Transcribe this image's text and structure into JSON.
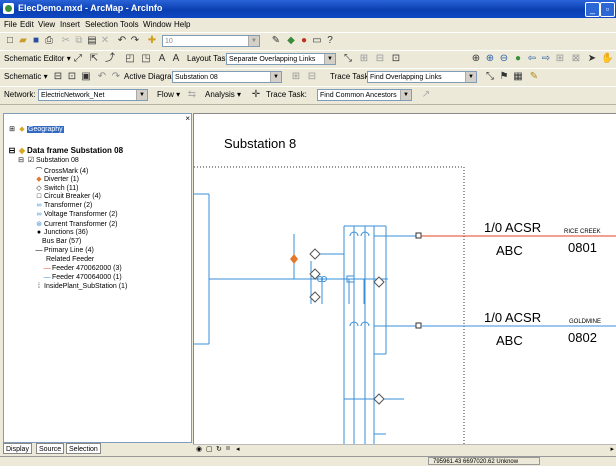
{
  "window": {
    "title": "ElecDemo.mxd - ArcMap - ArcInfo"
  },
  "menu": [
    "File",
    "Edit",
    "View",
    "Insert",
    "Selection",
    "Tools",
    "Window",
    "Help"
  ],
  "standard_toolbar": {
    "scale_value": "10"
  },
  "schematic_editor_toolbar": {
    "label": "Schematic Editor ▾",
    "layout_task_label": "Layout Task:",
    "layout_task_value": "Separate Overlapping Links"
  },
  "schematic_toolbar": {
    "label": "Schematic ▾",
    "active_diagram_label": "Active Diagram:",
    "active_diagram_value": "Substation 08",
    "trace_task_label": "Trace Task:",
    "trace_task_value": "Find Overlapping Links"
  },
  "network_toolbar": {
    "network_label": "Network:",
    "network_value": "ElectricNetwork_Net",
    "flow_label": "Flow ▾",
    "analysis_label": "Analysis ▾",
    "trace_task_label": "Trace Task:",
    "trace_task_value": "Find Common Ancestors"
  },
  "toc": {
    "layers": [
      {
        "label": "Geography",
        "selected": true
      },
      {
        "label": "Data frame Substation 08"
      },
      {
        "label": "Substation 08"
      },
      {
        "label": "CrossMark  (4)",
        "icon": "crossmark-icon"
      },
      {
        "label": "Diverter  (1)",
        "icon": "diverter-icon"
      },
      {
        "label": "Switch  (11)",
        "icon": "switch-icon"
      },
      {
        "label": "Circuit Breaker  (4)",
        "icon": "circuit-breaker-icon"
      },
      {
        "label": "Transformer  (2)",
        "icon": "transformer-icon"
      },
      {
        "label": "Voltage Transformer  (2)",
        "icon": "voltage-transformer-icon"
      },
      {
        "label": "Current Transformer  (2)",
        "icon": "current-transformer-icon"
      },
      {
        "label": "Junctions  (36)",
        "icon": "junction-icon"
      },
      {
        "label": "Bus Bar  (57)"
      },
      {
        "label": "Primary Line  (4)",
        "icon": "line-icon"
      },
      {
        "label": "Related Feeder"
      },
      {
        "label": "Feeder 470062000  (3)",
        "icon": "feeder-red-icon",
        "color": "#e0401c"
      },
      {
        "label": "Feeder 470064000  (1)",
        "icon": "feeder-blue-icon",
        "color": "#3a8fd8"
      },
      {
        "label": "InsidePlant_SubStation  (1)",
        "icon": "dotted-box-icon"
      }
    ],
    "tabs": [
      "Display",
      "Source",
      "Selection"
    ]
  },
  "map": {
    "title": "Substation 8",
    "feeders": [
      {
        "conductor": "1/0 ACSR",
        "phase": "ABC",
        "name": "RICE CREEK",
        "number": "0801",
        "color": "#e0401c"
      },
      {
        "conductor": "1/0 ACSR",
        "phase": "ABC",
        "name": "GOLDMINE",
        "number": "0802",
        "color": "#3a8fd8"
      }
    ],
    "line_color": "#3a8fd8",
    "diverter_color": "#e07a2c"
  },
  "status": {
    "coordinates": "795961.43  6697020.62 Unknow"
  }
}
